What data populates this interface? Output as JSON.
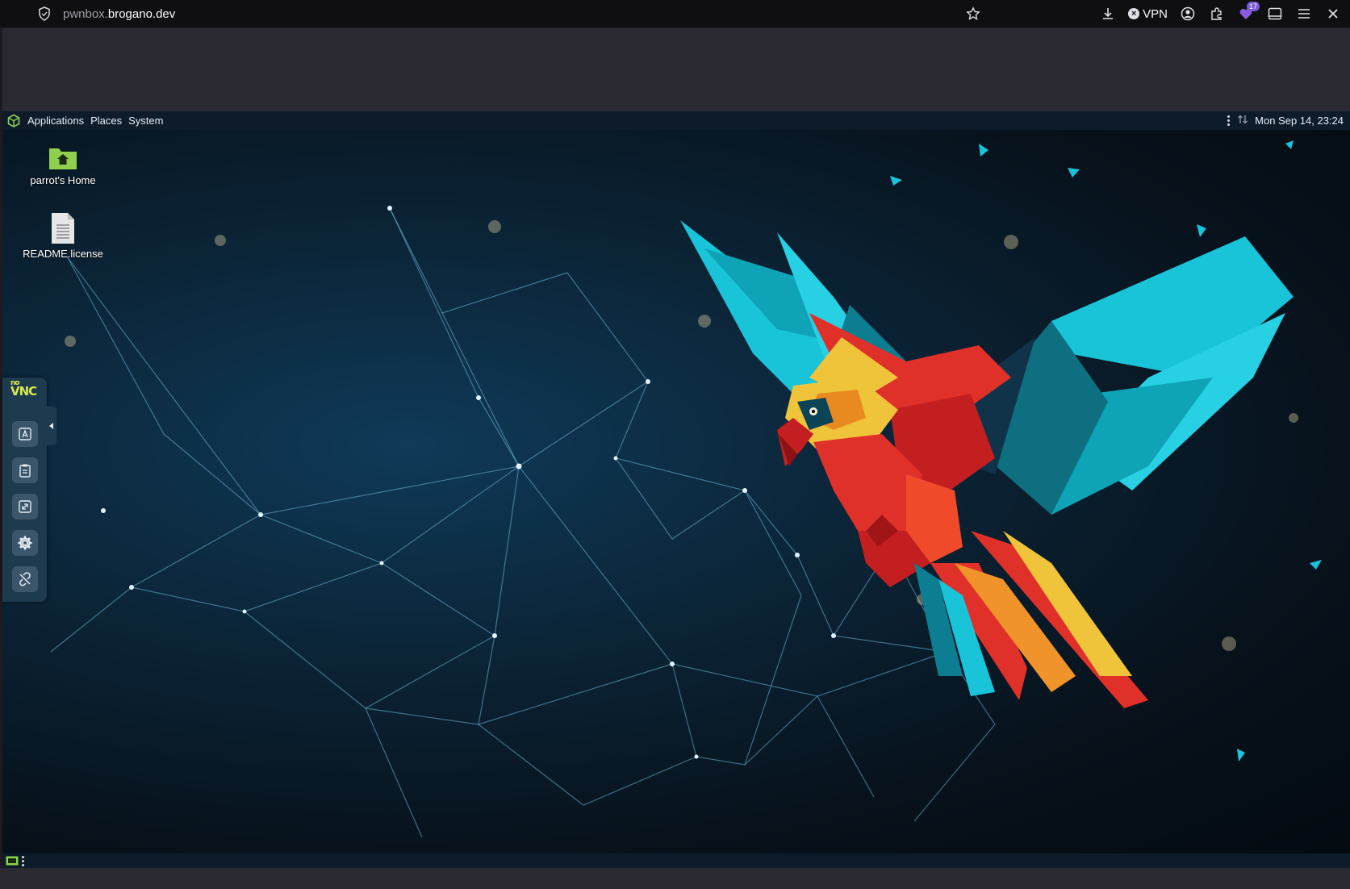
{
  "browser": {
    "url_prefix": "pwnbox.",
    "url_host": "brogano.dev",
    "vpn_label": "VPN",
    "extension_badge": "17"
  },
  "desktop": {
    "panel": {
      "applications": "Applications",
      "places": "Places",
      "system": "System",
      "datetime": "Mon Sep 14, 23:24"
    },
    "icons": [
      {
        "label": "parrot's Home"
      },
      {
        "label": "README.license"
      }
    ]
  },
  "novnc": {
    "logo_top": "no",
    "logo_main": "VNC"
  },
  "colors": {
    "browser_bg": "#0f0f12",
    "panel_bg": "#0e1c2a",
    "folder_green": "#8fd14f",
    "novnc_accent": "#d6e94a",
    "parrot_red": "#e0302a",
    "parrot_cyan": "#19c3d8",
    "parrot_yellow": "#f0c43a"
  }
}
